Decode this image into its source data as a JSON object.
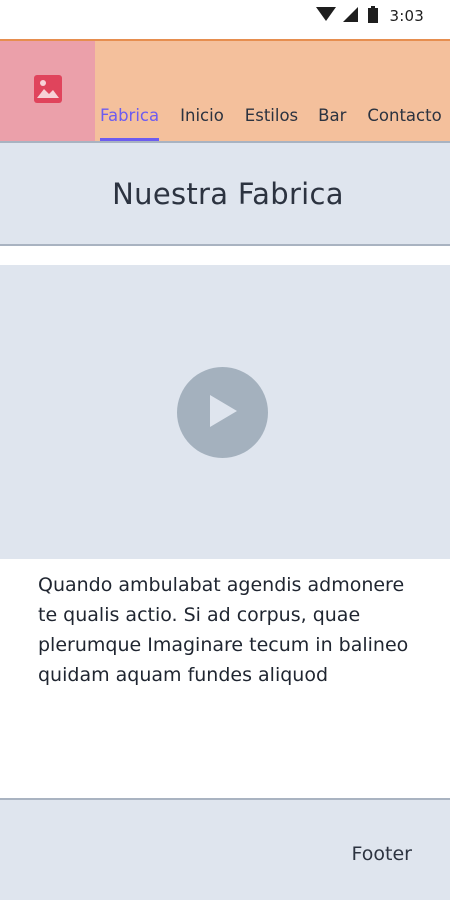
{
  "status_bar": {
    "time": "3:03",
    "icons": [
      "wifi-icon",
      "signal-icon",
      "battery-icon"
    ]
  },
  "header": {
    "logo_icon": "image-icon",
    "tabs": [
      {
        "label": "Fabrica",
        "active": true
      },
      {
        "label": "Inicio",
        "active": false
      },
      {
        "label": "Estilos",
        "active": false
      },
      {
        "label": "Bar",
        "active": false
      },
      {
        "label": "Contacto",
        "active": false
      }
    ]
  },
  "main": {
    "title": "Nuestra Fabrica",
    "video": {
      "play_icon": "play-icon"
    },
    "paragraph": "Quando ambulabat agendis admonere te qualis actio. Si ad corpus, quae plerumque Imaginare tecum in balineo quidam aquam fundes aliquod"
  },
  "footer": {
    "label": "Footer"
  },
  "colors": {
    "header_bg": "#f4c09c",
    "header_top_border": "#e68e4f",
    "logo_bg": "#eba0aa",
    "logo_icon": "#e0445c",
    "accent": "#6d5cf0",
    "panel_bg": "#dfe5ee",
    "play_button": "#a4b1be"
  }
}
